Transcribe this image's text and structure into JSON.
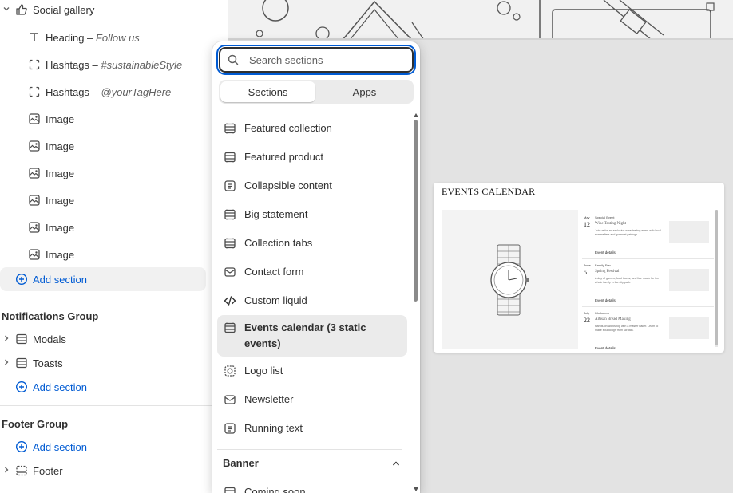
{
  "sidebar": {
    "social_gallery": {
      "label": "Social gallery"
    },
    "blocks": [
      {
        "label": "Heading",
        "sub": "Follow us",
        "icon": "text-icon"
      },
      {
        "label": "Hashtags",
        "sub": "#sustainableStyle",
        "icon": "frame-icon"
      },
      {
        "label": "Hashtags",
        "sub": "@yourTagHere",
        "icon": "frame-icon"
      },
      {
        "label": "Image",
        "sub": "",
        "icon": "image-icon"
      },
      {
        "label": "Image",
        "sub": "",
        "icon": "image-icon"
      },
      {
        "label": "Image",
        "sub": "",
        "icon": "image-icon"
      },
      {
        "label": "Image",
        "sub": "",
        "icon": "image-icon"
      },
      {
        "label": "Image",
        "sub": "",
        "icon": "image-icon"
      },
      {
        "label": "Image",
        "sub": "",
        "icon": "image-icon"
      }
    ],
    "separator": " – ",
    "add_section_label": "Add section",
    "notifications_group": {
      "title": "Notifications Group",
      "items": [
        {
          "label": "Modals"
        },
        {
          "label": "Toasts"
        }
      ]
    },
    "footer_group": {
      "title": "Footer Group",
      "items": [
        {
          "label": "Footer"
        }
      ]
    }
  },
  "picker": {
    "search_placeholder": "Search sections",
    "tabs": [
      {
        "label": "Sections",
        "active": true
      },
      {
        "label": "Apps",
        "active": false
      }
    ],
    "items": [
      {
        "label": "Featured collection",
        "icon": "layout-rows-icon"
      },
      {
        "label": "Featured product",
        "icon": "layout-rows-icon"
      },
      {
        "label": "Collapsible content",
        "icon": "text-block-icon"
      },
      {
        "label": "Big statement",
        "icon": "layout-rows-icon"
      },
      {
        "label": "Collection tabs",
        "icon": "layout-rows-icon"
      },
      {
        "label": "Contact form",
        "icon": "email-icon"
      },
      {
        "label": "Custom liquid",
        "icon": "code-icon"
      },
      {
        "label": "Events calendar (3 static events)",
        "icon": "layout-rows-icon",
        "selected": true
      },
      {
        "label": "Logo list",
        "icon": "logo-icon"
      },
      {
        "label": "Newsletter",
        "icon": "email-icon"
      },
      {
        "label": "Running text",
        "icon": "text-block-icon"
      }
    ],
    "category": {
      "label": "Banner",
      "expanded": true
    },
    "next_item": {
      "label": "Coming soon",
      "icon": "layout-rows-icon"
    }
  },
  "preview": {
    "title": "EVENTS CALENDAR",
    "events": [
      {
        "month": "May",
        "day": "12",
        "tag": "Special Event",
        "name": "Wine Tasting Night",
        "desc": "Join us for an exclusive wine tasting event with local sommeliers and gourmet pairings.",
        "link": "Event details"
      },
      {
        "month": "June",
        "day": "5",
        "tag": "Family Fun",
        "name": "Spring Festival",
        "desc": "A day of games, food trucks, and live music for the whole family in the city park.",
        "link": "Event details"
      },
      {
        "month": "July",
        "day": "22",
        "tag": "Workshop",
        "name": "Artisan Bread Making",
        "desc": "Hands-on workshop with a master baker. Learn to make sourdough from scratch.",
        "link": "Event details"
      }
    ]
  },
  "colors": {
    "accent": "#005bd3",
    "text": "#303030",
    "selected_bg": "#ebebeb"
  }
}
